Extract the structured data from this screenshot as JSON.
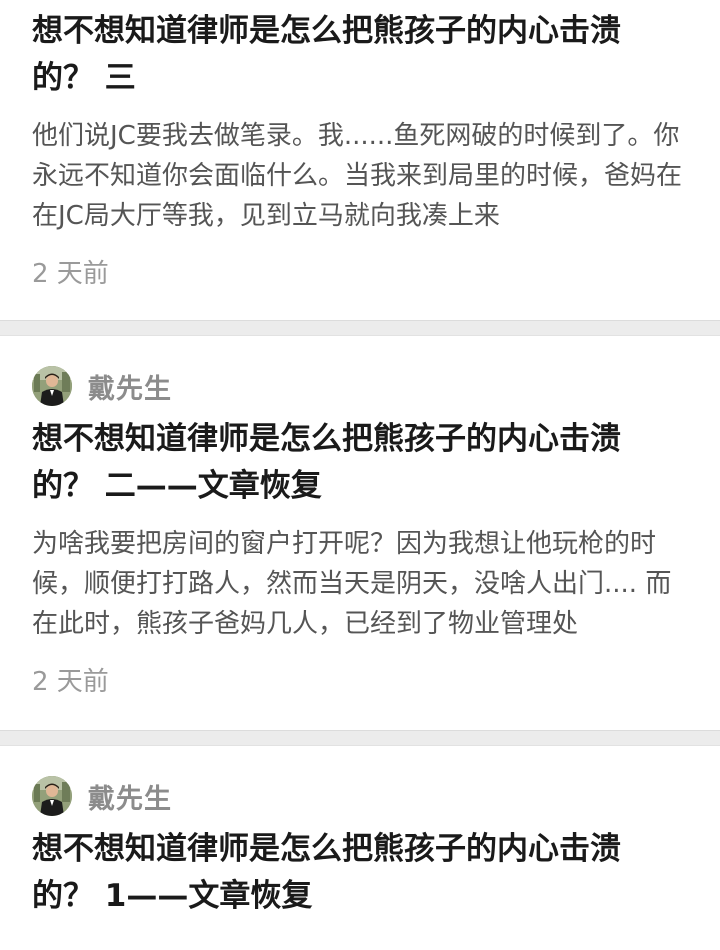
{
  "articles": [
    {
      "title": "想不想知道律师是怎么把熊孩子的内心击溃\n的？ 三",
      "excerpt": "他们说JC要我去做笔录。我......鱼死网破的时候到了。你永远不知道你会面临什么。当我来到局里的时候，爸妈在在JC局大厅等我，见到立马就向我凑上来",
      "time": "2 天前"
    },
    {
      "author": "戴先生",
      "avatar_icon": "user-photo-avatar",
      "title": "想不想知道律师是怎么把熊孩子的内心击溃\n的？ 二——文章恢复",
      "excerpt": "为啥我要把房间的窗户打开呢？因为我想让他玩枪的时候，顺便打打路人，然而当天是阴天，没啥人出门.... 而在此时，熊孩子爸妈几人，已经到了物业管理处",
      "time": "2 天前"
    },
    {
      "author": "戴先生",
      "avatar_icon": "user-photo-avatar",
      "title": "想不想知道律师是怎么把熊孩子的内心击溃\n的？ 1——文章恢复"
    }
  ],
  "colors": {
    "separator": "#ececec",
    "title": "#1a1a1a",
    "excerpt": "#555555",
    "meta": "#9a9a9a"
  }
}
